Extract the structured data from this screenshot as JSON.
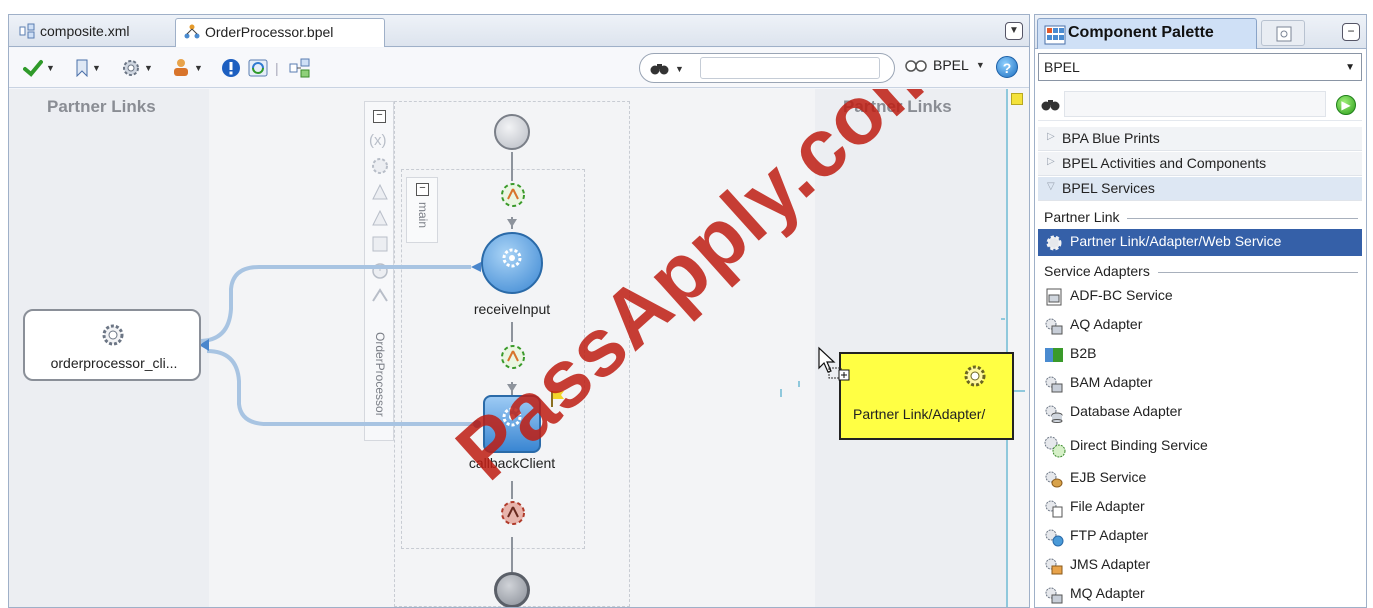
{
  "editor": {
    "tabs": [
      {
        "label": "composite.xml"
      },
      {
        "label": "OrderProcessor.bpel"
      }
    ],
    "toolbar": {
      "search_value": "",
      "bpel_label": "BPEL",
      "help_label": "?"
    },
    "canvas": {
      "left_header": "Partner Links",
      "right_header": "Partner Links",
      "main_label": "main",
      "process_label": "OrderProcessor",
      "partner_link_node": "orderprocessor_cli...",
      "activities": [
        {
          "label": "receiveInput"
        },
        {
          "label": "callbackClient"
        }
      ],
      "dragged_item": "Partner Link/Adapter/"
    }
  },
  "palette": {
    "title": "Component Palette",
    "page_select": "BPEL",
    "search_value": "",
    "categories": [
      {
        "label": "BPA Blue Prints",
        "expanded": false
      },
      {
        "label": "BPEL Activities and Components",
        "expanded": false
      },
      {
        "label": "BPEL Services",
        "expanded": true
      }
    ],
    "sections": {
      "partner_link": "Partner Link",
      "service_adapters": "Service Adapters"
    },
    "partner_link_items": [
      {
        "label": "Partner Link/Adapter/Web Service",
        "selected": true
      }
    ],
    "adapter_items": [
      {
        "label": "ADF-BC Service"
      },
      {
        "label": "AQ Adapter"
      },
      {
        "label": "B2B"
      },
      {
        "label": "BAM Adapter"
      },
      {
        "label": "Database Adapter"
      },
      {
        "label": "Direct Binding Service"
      },
      {
        "label": "EJB Service"
      },
      {
        "label": "File Adapter"
      },
      {
        "label": "FTP Adapter"
      },
      {
        "label": "JMS Adapter"
      },
      {
        "label": "MQ Adapter"
      }
    ]
  },
  "watermark": "PassApply.com",
  "colors": {
    "selection": "#3560a8",
    "activity_blue": "#4a90d9",
    "drag_yellow": "#ffff44",
    "watermark_red": "#be1e14"
  }
}
